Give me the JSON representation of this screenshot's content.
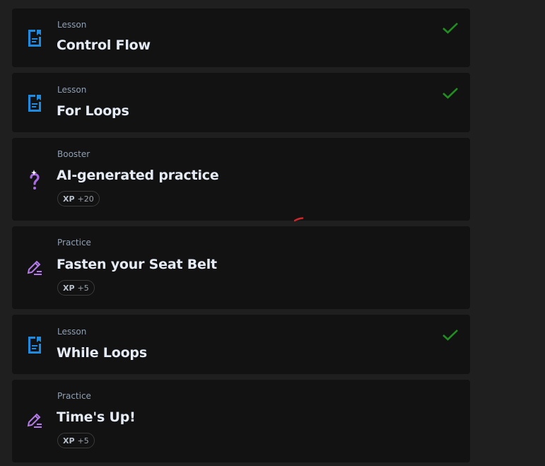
{
  "colors": {
    "background": "#1f1f1f",
    "card": "#121212",
    "lesson_icon": "#1e8be0",
    "practice_icon": "#b47be8",
    "booster_icon": "#a86be0",
    "check": "#1f8f1f",
    "annotation_stroke": "#d0282a"
  },
  "items": [
    {
      "kind": "Lesson",
      "title": "Control Flow",
      "icon": "document-icon",
      "completed": true
    },
    {
      "kind": "Lesson",
      "title": "For Loops",
      "icon": "document-icon",
      "completed": true
    },
    {
      "kind": "Booster",
      "title": "AI-generated practice",
      "icon": "question-sparkle-icon",
      "xp_label": "XP",
      "xp_value": "+20",
      "completed": false
    },
    {
      "kind": "Practice",
      "title": "Fasten your Seat Belt",
      "icon": "pencil-icon",
      "xp_label": "XP",
      "xp_value": "+5",
      "completed": false
    },
    {
      "kind": "Lesson",
      "title": "While Loops",
      "icon": "document-icon",
      "completed": true
    },
    {
      "kind": "Practice",
      "title": "Time's Up!",
      "icon": "pencil-icon",
      "xp_label": "XP",
      "xp_value": "+5",
      "completed": false
    }
  ]
}
